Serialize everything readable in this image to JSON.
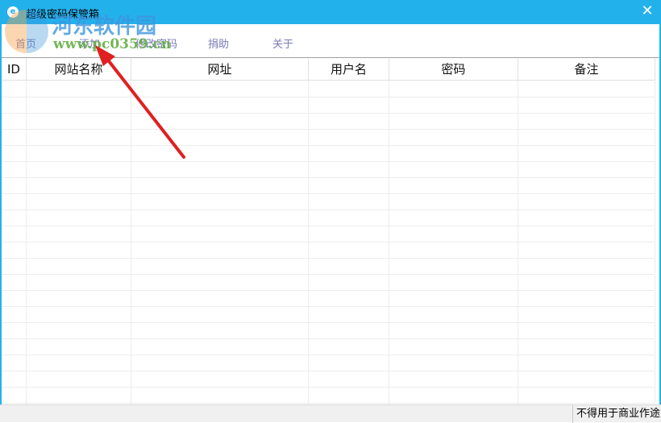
{
  "window": {
    "title": "超级密码保管箱",
    "close": "✕",
    "icon": "e"
  },
  "menu": [
    "首页",
    "添加",
    "修改密码",
    "捐助",
    "关于"
  ],
  "table": {
    "columns": [
      "ID",
      "网站名称",
      "网址",
      "用户名",
      "密码",
      "备注"
    ],
    "rows": []
  },
  "status": {
    "text": "不得用于商业作途"
  },
  "watermark": {
    "name": "河东软件园",
    "url": "www.pc0359.cn"
  },
  "colors": {
    "accent": "#23b1ec",
    "menu_text": "#7a7ab8",
    "arrow": "#e02020"
  }
}
